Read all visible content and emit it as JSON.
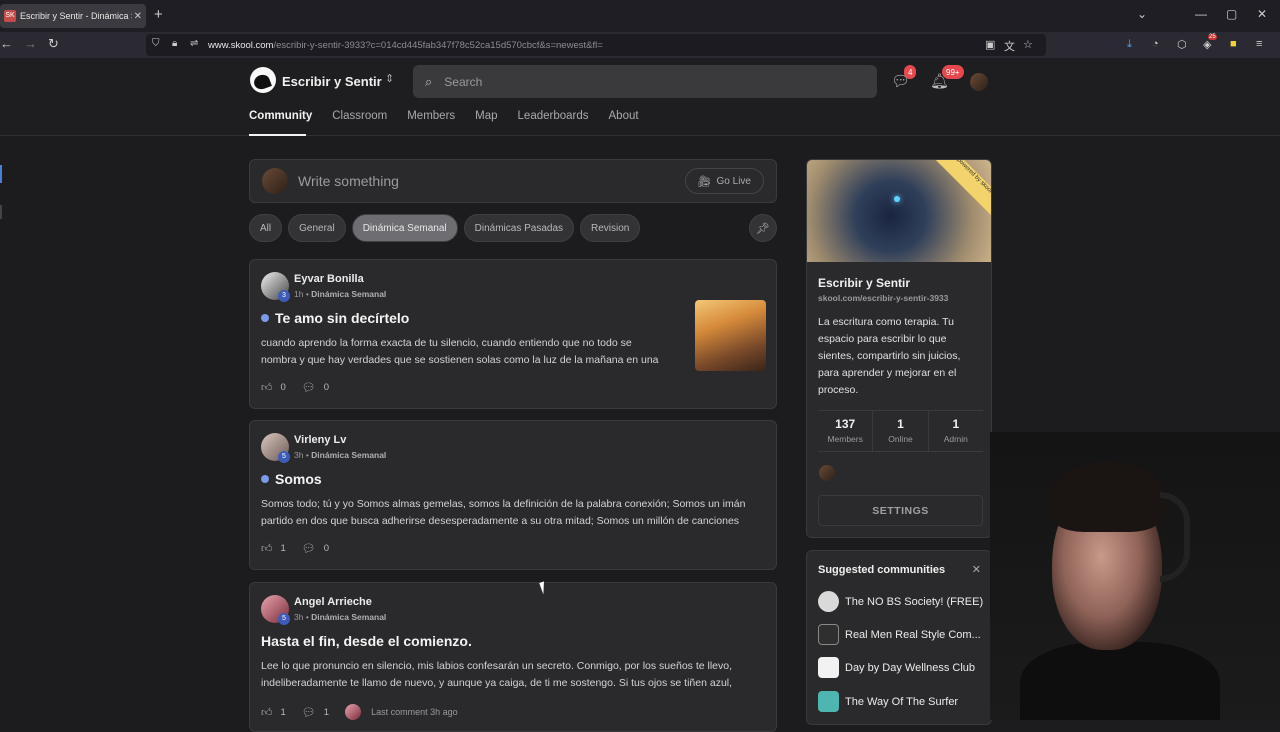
{
  "browser": {
    "tab_title": "Escribir y Sentir - Dinámica Sema",
    "favicon_text": "SK",
    "url_host": "www.skool.com",
    "url_path": "/escribir-y-sentir-3933?c=014cd445fab347f78c52ca15d570cbcf&s=newest&fl=",
    "ext_badge": "25"
  },
  "header": {
    "brand": "Escribir y Sentir",
    "search_placeholder": "Search",
    "chat_badge": "4",
    "notif_badge": "99+",
    "nav": [
      "Community",
      "Classroom",
      "Members",
      "Map",
      "Leaderboards",
      "About"
    ]
  },
  "composer": {
    "placeholder": "Write something",
    "golive": "Go Live"
  },
  "filters": [
    "All",
    "General",
    "Dinámica Semanal",
    "Dinámicas Pasadas",
    "Revision"
  ],
  "posts": [
    {
      "author": "Eyvar Bonilla",
      "level": "3",
      "time": "1h",
      "category": "Dinámica Semanal",
      "title": "Te amo sin decírtelo",
      "body1": "cuando aprendo la forma exacta de tu silencio, cuando entiendo que no todo se",
      "body2": "nombra y que hay verdades que se sostienen solas como la luz de la mañana en una",
      "likes": "0",
      "comments": "0"
    },
    {
      "author": "Virleny Lv",
      "level": "5",
      "time": "3h",
      "category": "Dinámica Semanal",
      "title": "Somos",
      "body1": "Somos todo; tú y yo Somos almas gemelas, somos la definición de la palabra conexión; Somos un imán",
      "body2": "partido en dos que busca adherirse desesperadamente a su otra mitad; Somos un millón de canciones",
      "likes": "1",
      "comments": "0"
    },
    {
      "author": "Angel Arrieche",
      "level": "5",
      "time": "3h",
      "category": "Dinámica Semanal",
      "title": "Hasta el fin, desde el comienzo.",
      "body1": "Lee lo que pronuncio en silencio, mis labios confesarán un secreto. Conmigo, por los sueños te llevo,",
      "body2": "indeliberadamente te llamo de nuevo, y aunque ya caiga, de ti me sostengo. Si tus ojos se tiñen azul,",
      "likes": "1",
      "comments": "1",
      "last_comment": "Last comment 3h ago"
    }
  ],
  "sidebar": {
    "ribbon": "powered by skool",
    "name": "Escribir y Sentir",
    "url": "skool.com/escribir-y-sentir-3933",
    "description": "La escritura como terapia. Tu espacio para escribir lo que sientes, compartirlo sin juicios, para aprender y mejorar en el proceso.",
    "stats": [
      {
        "num": "137",
        "label": "Members"
      },
      {
        "num": "1",
        "label": "Online"
      },
      {
        "num": "1",
        "label": "Admin"
      }
    ],
    "settings": "SETTINGS"
  },
  "suggested": {
    "title": "Suggested communities",
    "items": [
      {
        "name": "The NO BS Society! (FREE)",
        "color": "#d9d9d9"
      },
      {
        "name": "Real Men Real Style Com...",
        "color": "#2f2f2f"
      },
      {
        "name": "Day by Day Wellness Club",
        "color": "#f2f2f2"
      },
      {
        "name": "The Way Of The Surfer",
        "color": "#4fb5b0"
      }
    ]
  }
}
